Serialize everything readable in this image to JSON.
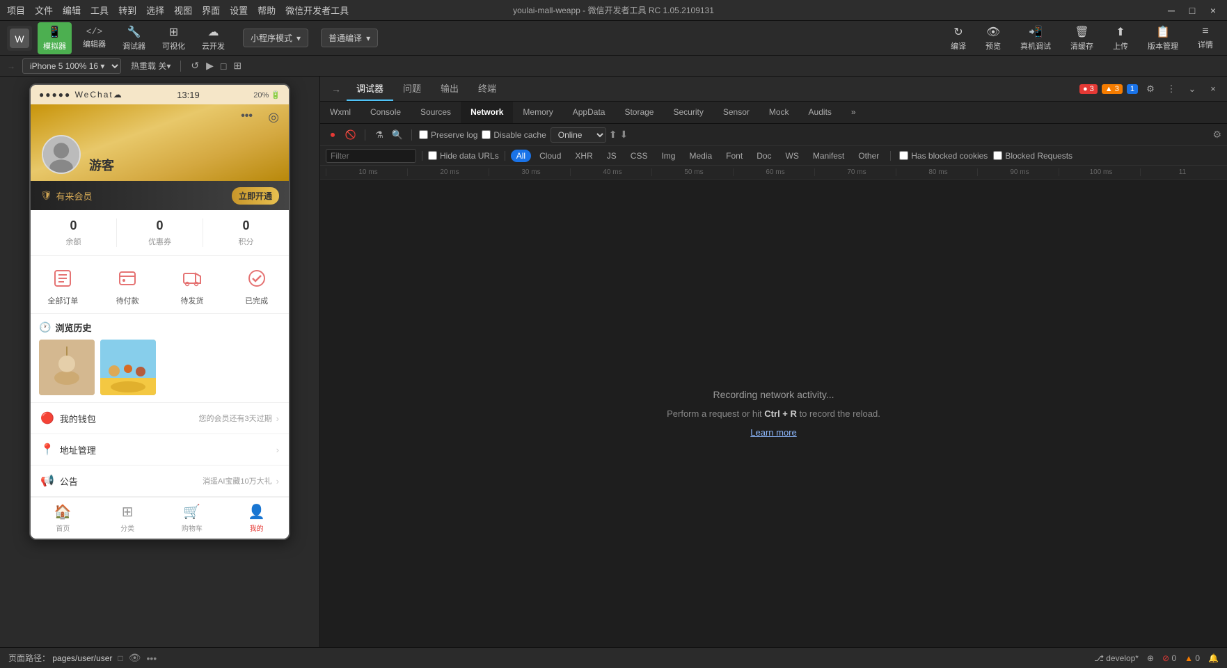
{
  "titlebar": {
    "menu_items": [
      "项目",
      "文件",
      "编辑",
      "工具",
      "转到",
      "选择",
      "视图",
      "界面",
      "设置",
      "帮助",
      "微信开发者工具"
    ],
    "title": "youlai-mall-weapp - 微信开发者工具 RC 1.05.2109131",
    "controls": [
      "─",
      "□",
      "×"
    ]
  },
  "toolbar": {
    "logo_text": "W",
    "buttons": [
      {
        "id": "simulator",
        "icon": "📱",
        "label": "模拟器"
      },
      {
        "id": "editor",
        "icon": "</>",
        "label": "编辑器"
      },
      {
        "id": "debugger",
        "icon": "⚙",
        "label": "调试器"
      },
      {
        "id": "visualize",
        "icon": "⊞",
        "label": "可视化"
      },
      {
        "id": "cloud",
        "icon": "☁",
        "label": "云开发"
      }
    ],
    "mode_selector": "小程序模式",
    "translate_selector": "普通编译",
    "right_buttons": [
      {
        "id": "compile",
        "icon": "↻",
        "label": "编译"
      },
      {
        "id": "preview",
        "icon": "👁",
        "label": "预览"
      },
      {
        "id": "real_debug",
        "icon": "📲",
        "label": "真机调试"
      },
      {
        "id": "clear_cache",
        "icon": "🗑",
        "label": "清缓存"
      },
      {
        "id": "upload",
        "icon": "⬆",
        "label": "上传"
      },
      {
        "id": "version_mgmt",
        "icon": "📋",
        "label": "版本管理"
      },
      {
        "id": "detail",
        "icon": "≡",
        "label": "详情"
      }
    ]
  },
  "secondary_toolbar": {
    "device": "iPhone 5",
    "scale": "100%",
    "bit_depth": "16",
    "hot_reload": "热重载 关▾",
    "icons": [
      "↺",
      "▶",
      "□",
      "⊞"
    ]
  },
  "phone": {
    "statusbar": {
      "signal": "●●●●●",
      "wechat": "WeChat",
      "wifi": "WiFi",
      "time": "13:19",
      "battery_pct": "20%"
    },
    "profile": {
      "username": "游客",
      "menu_dots": "•••",
      "camera_icon": "◎"
    },
    "membership": {
      "badge_icon": "🛡",
      "badge_text": "有来会员",
      "activate_btn": "立即开通"
    },
    "stats": [
      {
        "num": "0",
        "label": "余额"
      },
      {
        "num": "0",
        "label": "优惠券"
      },
      {
        "num": "0",
        "label": "积分"
      }
    ],
    "orders": [
      {
        "label": "全部订单"
      },
      {
        "label": "待付款"
      },
      {
        "label": "待发货"
      },
      {
        "label": "已完成"
      }
    ],
    "history": {
      "title": "浏览历史",
      "clock_icon": "🕐"
    },
    "menu_items": [
      {
        "icon": "💰",
        "label": "我的钱包",
        "note": "您的会员还有3天过期",
        "arrow": true
      },
      {
        "icon": "📍",
        "label": "地址管理",
        "note": "",
        "arrow": true
      },
      {
        "icon": "📢",
        "label": "公告",
        "note": "消遥AI宝藏10万大礼",
        "arrow": true
      }
    ],
    "bottom_nav": [
      {
        "icon": "🏠",
        "label": "首页",
        "active": false
      },
      {
        "icon": "⊞",
        "label": "分类",
        "active": false
      },
      {
        "icon": "🛒",
        "label": "购物车",
        "active": false
      },
      {
        "icon": "👤",
        "label": "我的",
        "active": true
      }
    ]
  },
  "devtools": {
    "tabs": [
      {
        "id": "debugger",
        "label": "调试器",
        "active": true
      },
      {
        "id": "issues",
        "label": "问题",
        "active": false
      },
      {
        "id": "output",
        "label": "输出",
        "active": false
      },
      {
        "id": "terminal",
        "label": "终端",
        "active": false
      }
    ],
    "inner_tabs": [
      {
        "id": "wxml",
        "label": "Wxml"
      },
      {
        "id": "console",
        "label": "Console"
      },
      {
        "id": "sources",
        "label": "Sources"
      },
      {
        "id": "network",
        "label": "Network",
        "active": true
      },
      {
        "id": "memory",
        "label": "Memory"
      },
      {
        "id": "appdata",
        "label": "AppData"
      },
      {
        "id": "storage",
        "label": "Storage"
      },
      {
        "id": "security",
        "label": "Security"
      },
      {
        "id": "sensor",
        "label": "Sensor"
      },
      {
        "id": "mock",
        "label": "Mock"
      },
      {
        "id": "audits",
        "label": "Audits"
      },
      {
        "id": "more",
        "label": "»"
      }
    ],
    "error_count": "3",
    "warning_count": "3",
    "info_count": "1",
    "network": {
      "filter_placeholder": "Filter",
      "hide_data_urls": "Hide data URLs",
      "filter_types": [
        "All",
        "Cloud",
        "XHR",
        "JS",
        "CSS",
        "Img",
        "Media",
        "Font",
        "Doc",
        "WS",
        "Manifest",
        "Other"
      ],
      "active_filter": "All",
      "has_blocked_cookies": "Has blocked cookies",
      "blocked_requests": "Blocked Requests",
      "preserve_log": "Preserve log",
      "disable_cache": "Disable cache",
      "connection": "Online",
      "recording_text": "Recording network activity...",
      "hint_text": "Perform a request or hit",
      "hint_shortcut": "Ctrl + R",
      "hint_suffix": "to record the reload.",
      "learn_more": "Learn more",
      "timeline_marks": [
        "10 ms",
        "20 ms",
        "30 ms",
        "40 ms",
        "50 ms",
        "60 ms",
        "70 ms",
        "80 ms",
        "90 ms",
        "100 ms",
        "11"
      ]
    }
  },
  "bottom_bar": {
    "path": "页面路径：",
    "page": "pages/user/user",
    "develop": "develop*",
    "connection_icon": "⊕",
    "error_count": "0",
    "warning_count": "0",
    "bell_icon": "🔔"
  }
}
